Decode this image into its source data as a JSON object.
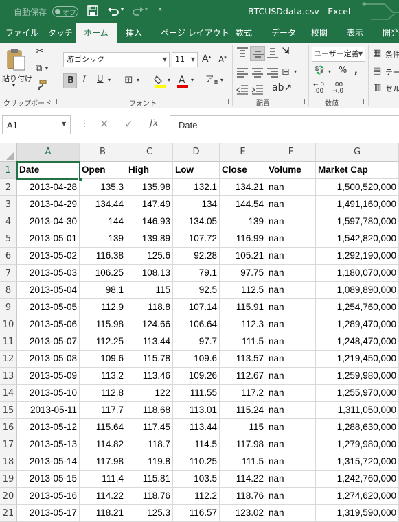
{
  "titlebar": {
    "autosave_label": "自動保存",
    "autosave_toggle": "オフ",
    "title": "BTCUSDdata.csv  -  Excel"
  },
  "tabs": [
    "ファイル",
    "タッチ",
    "ホーム",
    "挿入",
    "ページ レイアウト",
    "数式",
    "データ",
    "校閲",
    "表示",
    "開発"
  ],
  "active_tab": "ホーム",
  "ribbon": {
    "clipboard": {
      "paste_label": "貼り付け",
      "group_label": "クリップボード"
    },
    "font": {
      "font_name": "游ゴシック",
      "font_size": "11",
      "group_label": "フォント"
    },
    "alignment": {
      "group_label": "配置"
    },
    "number": {
      "format": "ユーザー定義",
      "group_label": "数値"
    },
    "styles": {
      "items": [
        "条件",
        "テー",
        "セル"
      ]
    }
  },
  "formula_bar": {
    "name_box": "A1",
    "fx": "fx",
    "content": "Date"
  },
  "grid": {
    "columns": [
      "A",
      "B",
      "C",
      "D",
      "E",
      "F",
      "G"
    ],
    "selected_column": "A",
    "selected_row": "1",
    "header": [
      "Date",
      "Open",
      "High",
      "Low",
      "Close",
      "Volume",
      "Market Cap"
    ],
    "rows": [
      [
        "2",
        "2013-04-28",
        "135.3",
        "135.98",
        "132.1",
        "134.21",
        "nan",
        "1,500,520,000"
      ],
      [
        "3",
        "2013-04-29",
        "134.44",
        "147.49",
        "134",
        "144.54",
        "nan",
        "1,491,160,000"
      ],
      [
        "4",
        "2013-04-30",
        "144",
        "146.93",
        "134.05",
        "139",
        "nan",
        "1,597,780,000"
      ],
      [
        "5",
        "2013-05-01",
        "139",
        "139.89",
        "107.72",
        "116.99",
        "nan",
        "1,542,820,000"
      ],
      [
        "6",
        "2013-05-02",
        "116.38",
        "125.6",
        "92.28",
        "105.21",
        "nan",
        "1,292,190,000"
      ],
      [
        "7",
        "2013-05-03",
        "106.25",
        "108.13",
        "79.1",
        "97.75",
        "nan",
        "1,180,070,000"
      ],
      [
        "8",
        "2013-05-04",
        "98.1",
        "115",
        "92.5",
        "112.5",
        "nan",
        "1,089,890,000"
      ],
      [
        "9",
        "2013-05-05",
        "112.9",
        "118.8",
        "107.14",
        "115.91",
        "nan",
        "1,254,760,000"
      ],
      [
        "10",
        "2013-05-06",
        "115.98",
        "124.66",
        "106.64",
        "112.3",
        "nan",
        "1,289,470,000"
      ],
      [
        "11",
        "2013-05-07",
        "112.25",
        "113.44",
        "97.7",
        "111.5",
        "nan",
        "1,248,470,000"
      ],
      [
        "12",
        "2013-05-08",
        "109.6",
        "115.78",
        "109.6",
        "113.57",
        "nan",
        "1,219,450,000"
      ],
      [
        "13",
        "2013-05-09",
        "113.2",
        "113.46",
        "109.26",
        "112.67",
        "nan",
        "1,259,980,000"
      ],
      [
        "14",
        "2013-05-10",
        "112.8",
        "122",
        "111.55",
        "117.2",
        "nan",
        "1,255,970,000"
      ],
      [
        "15",
        "2013-05-11",
        "117.7",
        "118.68",
        "113.01",
        "115.24",
        "nan",
        "1,311,050,000"
      ],
      [
        "16",
        "2013-05-12",
        "115.64",
        "117.45",
        "113.44",
        "115",
        "nan",
        "1,288,630,000"
      ],
      [
        "17",
        "2013-05-13",
        "114.82",
        "118.7",
        "114.5",
        "117.98",
        "nan",
        "1,279,980,000"
      ],
      [
        "18",
        "2013-05-14",
        "117.98",
        "119.8",
        "110.25",
        "111.5",
        "nan",
        "1,315,720,000"
      ],
      [
        "19",
        "2013-05-15",
        "111.4",
        "115.81",
        "103.5",
        "114.22",
        "nan",
        "1,242,760,000"
      ],
      [
        "20",
        "2013-05-16",
        "114.22",
        "118.76",
        "112.2",
        "118.76",
        "nan",
        "1,274,620,000"
      ],
      [
        "21",
        "2013-05-17",
        "118.21",
        "125.3",
        "116.57",
        "123.02",
        "nan",
        "1,319,590,000"
      ]
    ]
  },
  "colors": {
    "excel_green": "#217346"
  }
}
